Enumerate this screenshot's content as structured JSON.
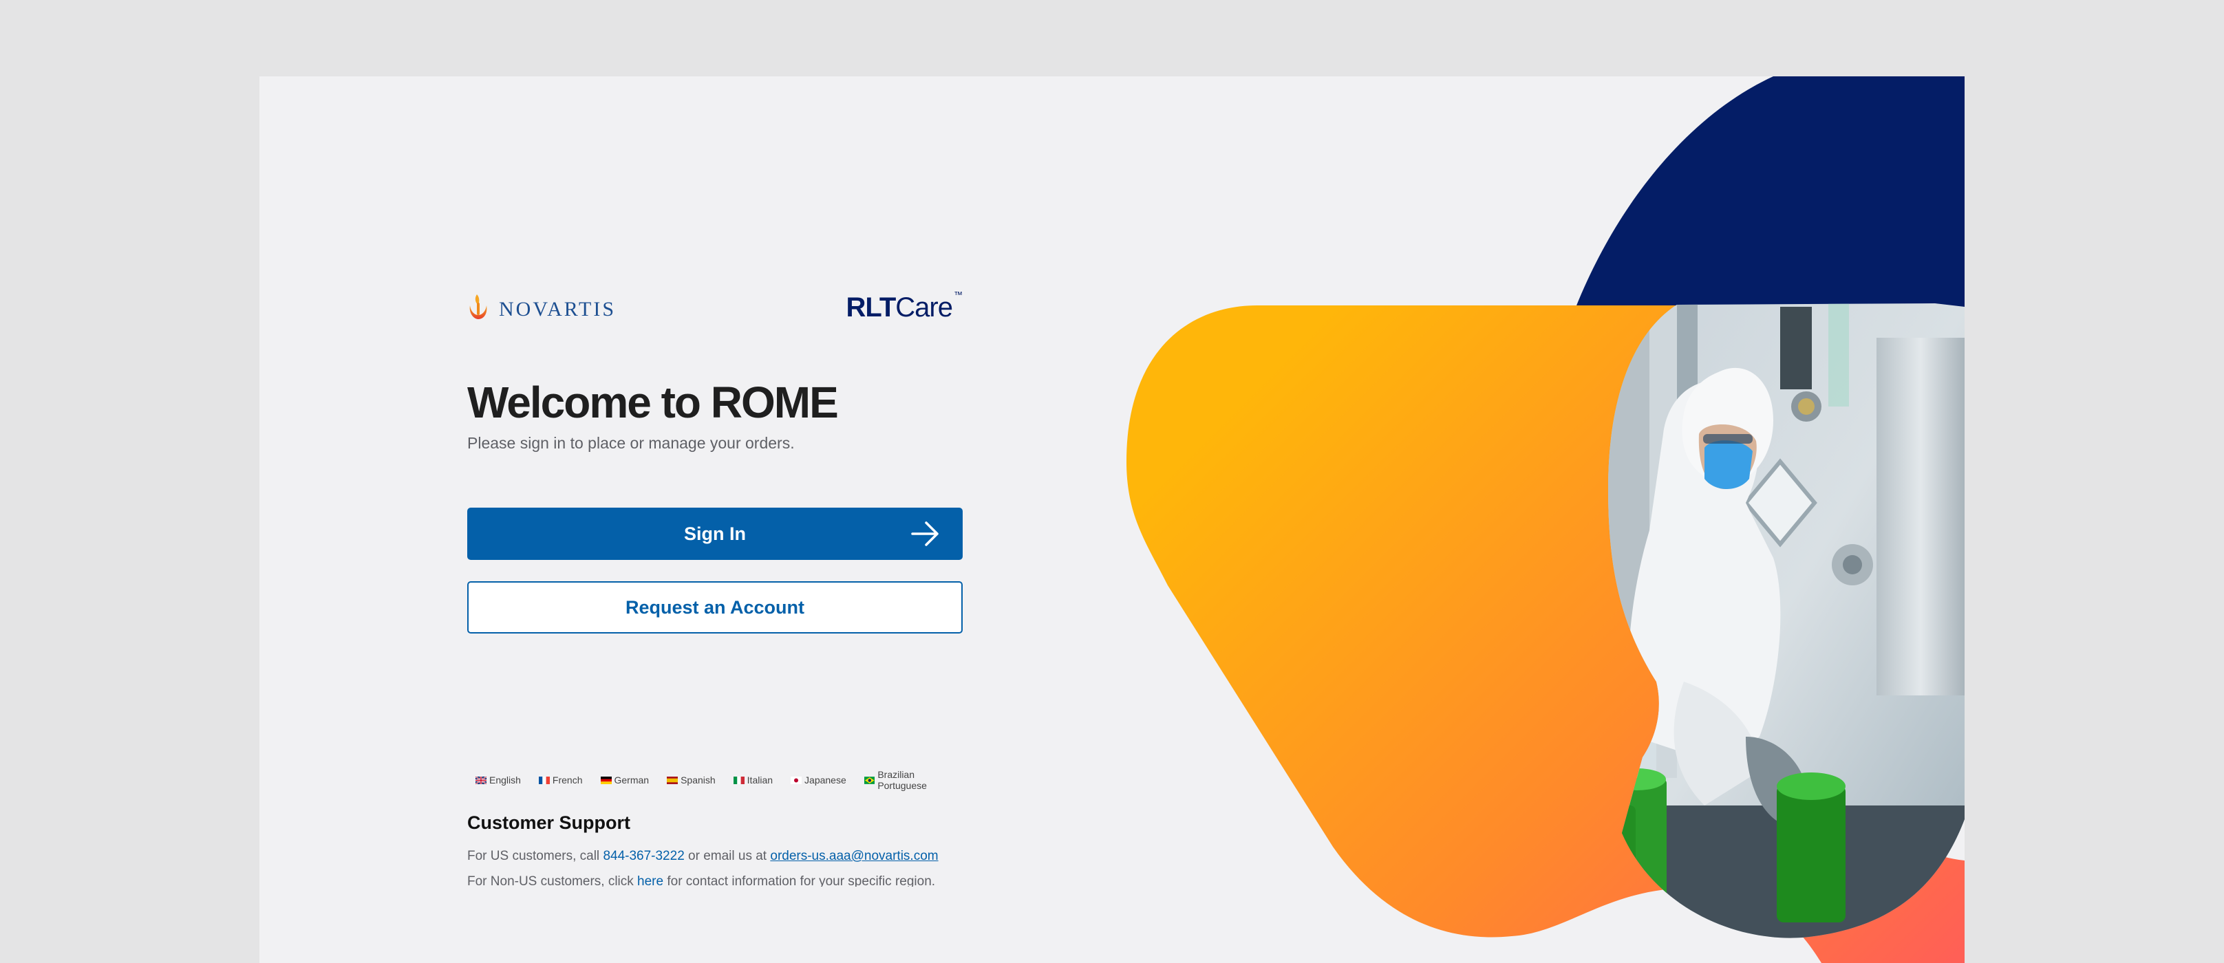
{
  "brand": {
    "novartis": "NOVARTIS",
    "rlt_bold": "RLT",
    "rlt_care": "Care",
    "rlt_tm": "™"
  },
  "welcome": {
    "title": "Welcome to ROME",
    "subtitle": "Please sign in to place or manage your orders."
  },
  "actions": {
    "sign_in": "Sign In",
    "request_account": "Request an Account"
  },
  "languages": [
    {
      "label": "English",
      "flag": "uk-flag"
    },
    {
      "label": "French",
      "flag": "france-flag"
    },
    {
      "label": "German",
      "flag": "germany-flag"
    },
    {
      "label": "Spanish",
      "flag": "spain-flag"
    },
    {
      "label": "Italian",
      "flag": "italy-flag"
    },
    {
      "label": "Japanese",
      "flag": "japan-flag"
    },
    {
      "label": "Brazilian Portuguese",
      "flag": "brazil-flag"
    }
  ],
  "support": {
    "title": "Customer Support",
    "us_prefix": "For US customers, call ",
    "phone": "844-367-3222",
    "us_mid": " or email us at ",
    "email": "orders-us.aaa@novartis.com",
    "non_us_prefix": "For Non-US customers, click ",
    "here": "here",
    "non_us_suffix": " for contact information for your specific region."
  },
  "colors": {
    "primary": "#0460a9",
    "navy": "#041d66",
    "orange_start": "#ffb60a",
    "orange_end": "#ff5f57"
  }
}
